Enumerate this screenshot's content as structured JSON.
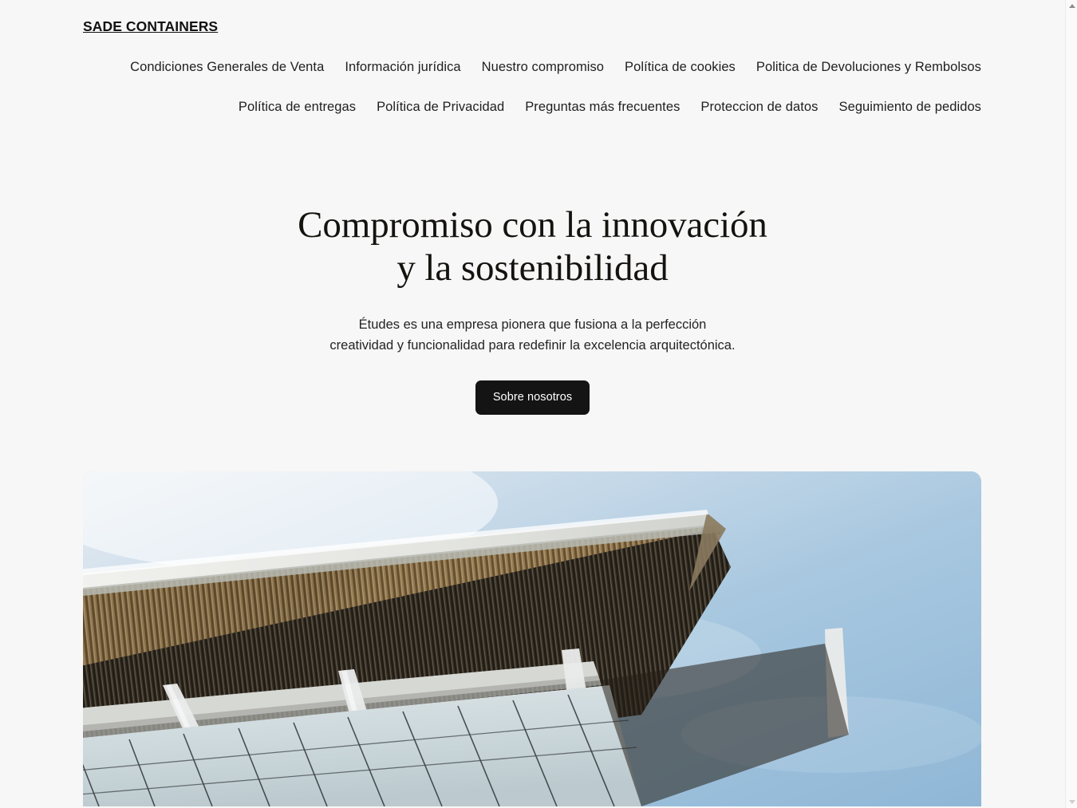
{
  "header": {
    "brand": "SADE CONTAINERS",
    "nav_items": [
      {
        "label": "Condiciones Generales de Venta",
        "name": "nav-link-condiciones-generales-de-venta"
      },
      {
        "label": "Información jurídica",
        "name": "nav-link-informacion-juridica"
      },
      {
        "label": "Nuestro compromiso",
        "name": "nav-link-nuestro-compromiso"
      },
      {
        "label": "Política de cookies",
        "name": "nav-link-politica-de-cookies"
      },
      {
        "label": "Politica de Devoluciones y Rembolsos",
        "name": "nav-link-politica-de-devoluciones-y-rembolsos"
      },
      {
        "label": "Política de entregas",
        "name": "nav-link-politica-de-entregas"
      },
      {
        "label": "Política de Privacidad",
        "name": "nav-link-politica-de-privacidad"
      },
      {
        "label": "Preguntas más frecuentes",
        "name": "nav-link-preguntas-mas-frecuentes"
      },
      {
        "label": "Proteccion de datos",
        "name": "nav-link-proteccion-de-datos"
      },
      {
        "label": "Seguimiento de pedidos",
        "name": "nav-link-seguimiento-de-pedidos"
      }
    ]
  },
  "hero": {
    "title_line1": "Compromiso con la innovación",
    "title_line2": "y la sostenibilidad",
    "subtitle_line1": "Études es una empresa pionera que fusiona a la perfección",
    "subtitle_line2": "creatividad y funcionalidad para redefinir la excelencia arquitectónica.",
    "cta_label": "Sobre nosotros",
    "image_alt": "Edificio moderno con alero de listones de madera y fachada de vidrio bajo un cielo azul"
  },
  "colors": {
    "page_background": "#f7f7f7",
    "text_primary": "#1d1d1d",
    "heading": "#14130f",
    "button_background": "#141414",
    "button_text": "#ffffff",
    "sky": "#9cc0dd",
    "wood": "#8c6f44"
  },
  "scrollbar": {
    "up_arrow": "scroll-up-arrow",
    "down_arrow": "scroll-down-arrow"
  }
}
